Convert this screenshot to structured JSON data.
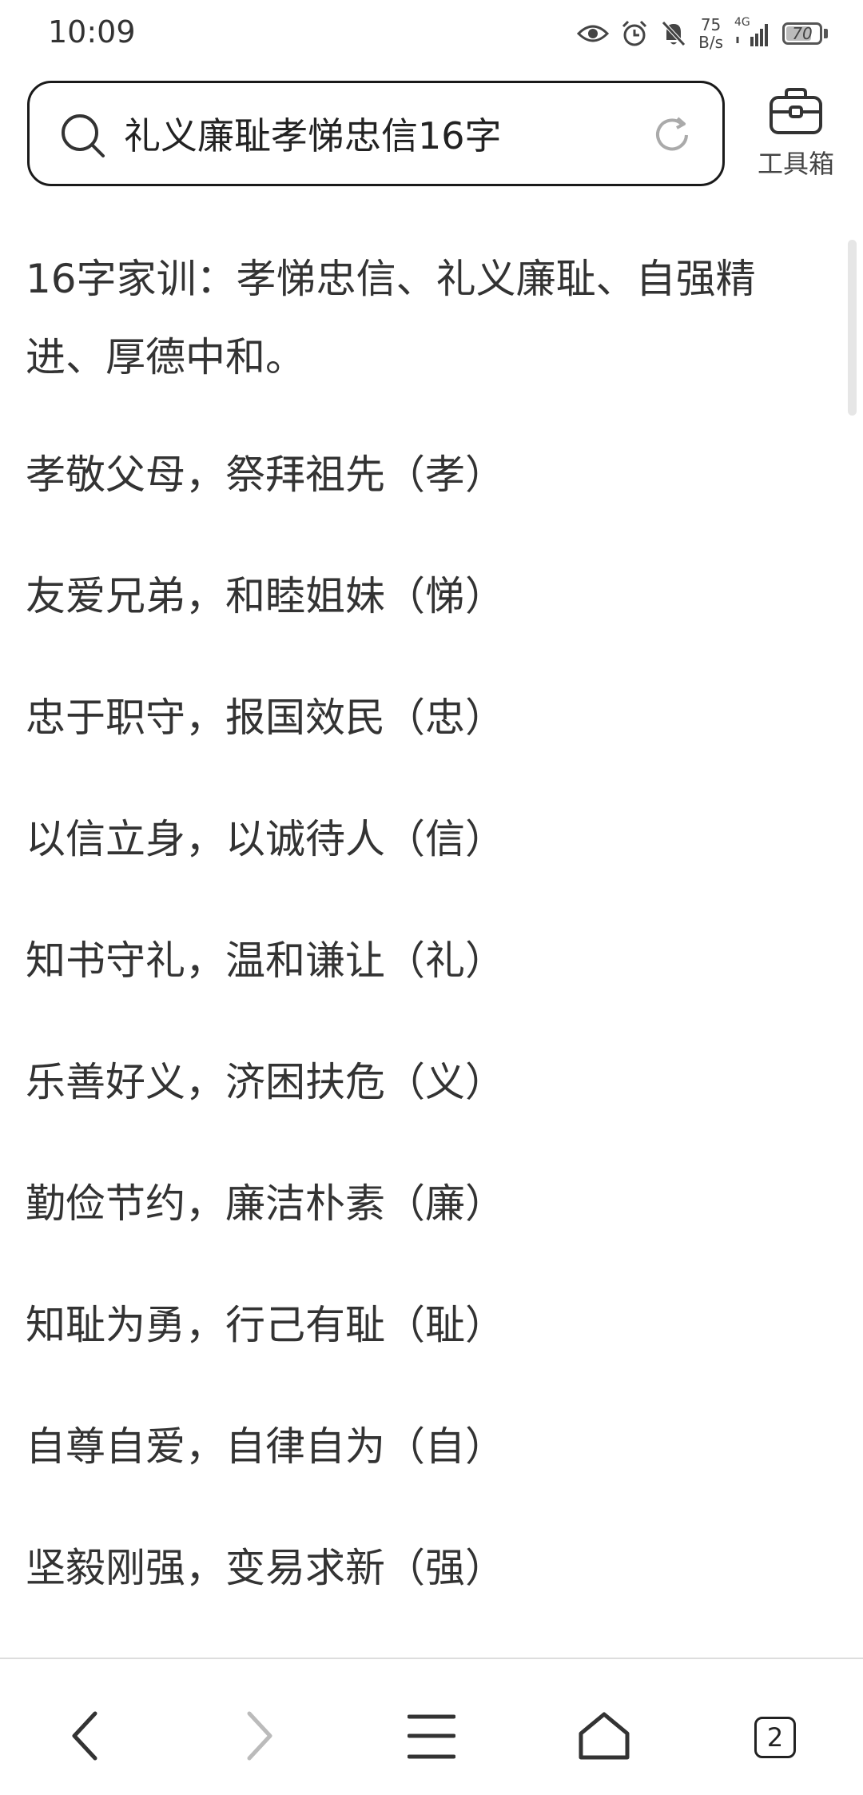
{
  "status_bar": {
    "time": "10:09",
    "net_speed_value": "75",
    "net_speed_unit": "B/s",
    "network": "4G",
    "battery": "70",
    "icons": [
      "eye-icon",
      "alarm-icon",
      "mute-icon",
      "signal-icon",
      "battery-icon"
    ]
  },
  "search": {
    "query": "礼义廉耻孝悌忠信16字"
  },
  "toolbox": {
    "label": "工具箱"
  },
  "content": {
    "intro": "16字家训：孝悌忠信、礼义廉耻、自强精进、厚德中和。",
    "lines": [
      "孝敬父母，祭拜祖先（孝）",
      "友爱兄弟，和睦姐妹（悌）",
      "忠于职守，报国效民（忠）",
      "以信立身，以诚待人（信）",
      "知书守礼，温和谦让（礼）",
      "乐善好义，济困扶危（义）",
      "勤俭节约，廉洁朴素（廉）",
      "知耻为勇，行己有耻（耻）",
      "自尊自爱，自律自为（自）",
      "坚毅刚强，变易求新（强）"
    ]
  },
  "bottom_nav": {
    "tabs_count": "2",
    "icons": [
      "back-icon",
      "forward-icon",
      "menu-icon",
      "home-icon",
      "tabs-icon"
    ]
  },
  "colors": {
    "text": "#333333",
    "disabled": "#bbbbbb",
    "border": "#1a1a1a"
  }
}
